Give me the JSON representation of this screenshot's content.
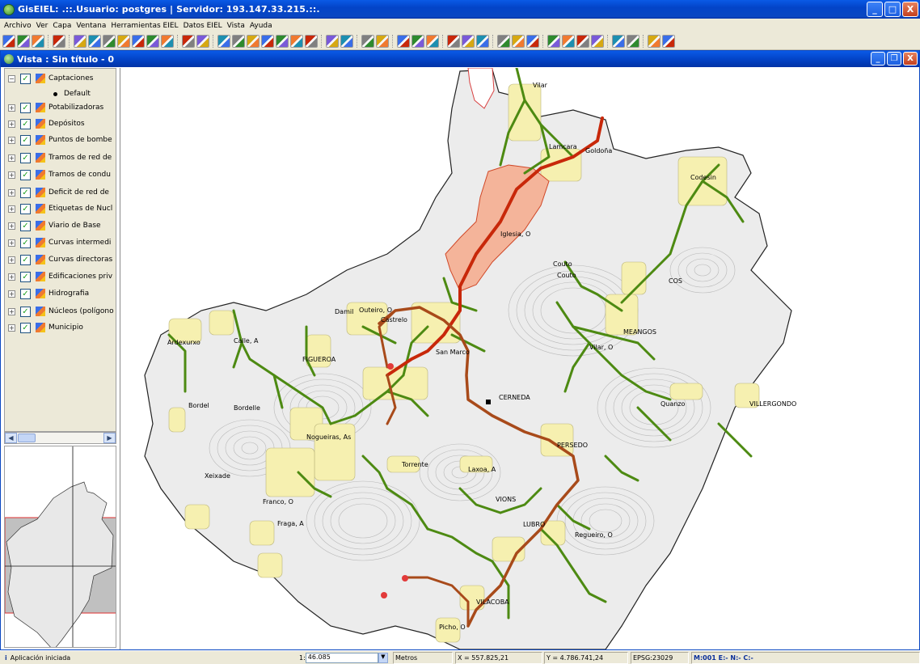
{
  "window": {
    "title": "GisEIEL: .::.Usuario: postgres | Servidor: 193.147.33.215.::.",
    "minimize": "_",
    "maximize": "□",
    "close": "X"
  },
  "menu": [
    "Archivo",
    "Ver",
    "Capa",
    "Ventana",
    "Herramientas EIEL",
    "Datos EIEL",
    "Vista",
    "Ayuda"
  ],
  "toolbar": {
    "icons": [
      "new-document-icon",
      "open-folder-icon",
      "save-icon",
      "layer-add-icon",
      "zoom-in-icon",
      "zoom-out-icon",
      "zoom-extent-icon",
      "layers-icon",
      "zoom-full-icon",
      "zoom-select-icon",
      "zoom-previous-icon",
      "pan-hand-icon",
      "print-icon",
      "info-icon",
      "measure-icon",
      "edit-icon",
      "select-icon",
      "select-rect-icon",
      "select-poly-icon",
      "refresh-icon",
      "table-icon",
      "rect-select-icon",
      "query-icon",
      "graph-icon",
      "list-icon",
      "calculator-icon",
      "settings-icon",
      "map-export-icon",
      "map-import-icon",
      "printer-icon",
      "copy-icon",
      "compare-icon",
      "duplicate-icon",
      "add-point-icon",
      "add-line-icon",
      "add-polygon-icon",
      "grid-icon",
      "network-icon",
      "network-edit-icon",
      "globe-icon",
      "report-icon"
    ]
  },
  "vista": {
    "title": "Vista : Sin título - 0"
  },
  "toc": {
    "layers": [
      {
        "name": "Captaciones",
        "checked": true,
        "expanded": true
      },
      {
        "name": "Potabilizadoras",
        "checked": true
      },
      {
        "name": "Depósitos",
        "checked": true
      },
      {
        "name": "Puntos de bombe",
        "checked": true
      },
      {
        "name": "Tramos de red de",
        "checked": true
      },
      {
        "name": "Tramos de condu",
        "checked": true
      },
      {
        "name": "Deficit de red de",
        "checked": true
      },
      {
        "name": "Etiquetas de Nucl",
        "checked": true
      },
      {
        "name": "Viario de Base",
        "checked": true
      },
      {
        "name": "Curvas intermedi",
        "checked": true
      },
      {
        "name": "Curvas directoras",
        "checked": true
      },
      {
        "name": "Edificaciones priv",
        "checked": true
      },
      {
        "name": "Hidrografia",
        "checked": true
      },
      {
        "name": "Núcleos (polígono",
        "checked": true
      },
      {
        "name": "Municipio",
        "checked": true
      }
    ],
    "legend_default": "Default"
  },
  "map": {
    "labels": [
      {
        "text": "Vilar",
        "key": "vilar"
      },
      {
        "text": "Lamcara",
        "key": "lamcara"
      },
      {
        "text": "Goldoña",
        "key": "goldona"
      },
      {
        "text": "Codesin",
        "key": "codesin"
      },
      {
        "text": "Iglesia, O",
        "key": "iglesia"
      },
      {
        "text": "Couto",
        "key": "couto1"
      },
      {
        "text": "Couto",
        "key": "couto2"
      },
      {
        "text": "COS",
        "key": "cos"
      },
      {
        "text": "Damil",
        "key": "damil"
      },
      {
        "text": "Outeiro, O",
        "key": "outeiro"
      },
      {
        "text": "Castrelo",
        "key": "castrelo"
      },
      {
        "text": "MEANGOS",
        "key": "meangos"
      },
      {
        "text": "Ardexurxo",
        "key": "ardexurxo"
      },
      {
        "text": "Calle, A",
        "key": "calle"
      },
      {
        "text": "San Marco",
        "key": "sanmarco"
      },
      {
        "text": "Vilar, O",
        "key": "vilaro"
      },
      {
        "text": "FIGUEROA",
        "key": "figueroa"
      },
      {
        "text": "CERNEDA",
        "key": "cerneda"
      },
      {
        "text": "Quanzo",
        "key": "quanzo"
      },
      {
        "text": "VILLERGONDO",
        "key": "villergondo"
      },
      {
        "text": "Bordel",
        "key": "bordel"
      },
      {
        "text": "Bordelle",
        "key": "bordelle"
      },
      {
        "text": "Nogueiras, As",
        "key": "nogueiras"
      },
      {
        "text": "PERSEDO",
        "key": "persedo"
      },
      {
        "text": "Torrente",
        "key": "torrente"
      },
      {
        "text": "Laxoa, A",
        "key": "laxoa"
      },
      {
        "text": "Xeixade",
        "key": "xeixade"
      },
      {
        "text": "VIONS",
        "key": "vions"
      },
      {
        "text": "Franco, O",
        "key": "franco"
      },
      {
        "text": "LUBRO",
        "key": "lubro"
      },
      {
        "text": "Fraga, A",
        "key": "fraga"
      },
      {
        "text": "Regueiro, O",
        "key": "regueiro"
      },
      {
        "text": "VILACOBA",
        "key": "vilacoba"
      },
      {
        "text": "Picho, O",
        "key": "picho"
      }
    ]
  },
  "status": {
    "message": "Aplicación iniciada",
    "scale_prefix": "1:",
    "scale_value": "46.085",
    "units": "Metros",
    "x_coord": "X = 557.825,21",
    "y_coord": "Y = 4.786.741,24",
    "epsg": "EPSG:23029",
    "mode": "M:001 E:- N:- C:-"
  },
  "colors": {
    "title_blue": "#0a47c2",
    "municipio_fill": "#e6e6e6",
    "road_green": "#4d8a12",
    "pipe_red": "#c8280a",
    "pipe_brown": "#a84a1a",
    "nucleus_fill": "#f7f2b4",
    "deficit_fill": "#f3b08f"
  }
}
